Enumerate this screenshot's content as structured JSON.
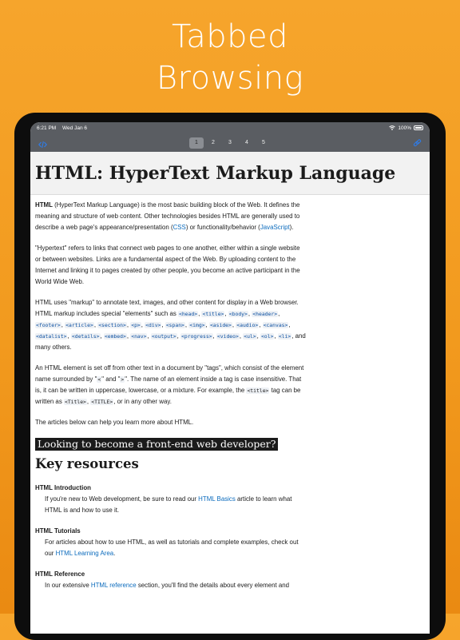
{
  "promo": {
    "line1": "Tabbed",
    "line2": "Browsing"
  },
  "status": {
    "time": "6:21 PM",
    "date": "Wed Jan 6",
    "battery": "100%"
  },
  "toolbar": {
    "tabs": [
      "1",
      "2",
      "3",
      "4",
      "5"
    ],
    "active_tab": "1",
    "left_icon": "code-icon",
    "right_icon": "link-icon",
    "accent": "#2f7be5"
  },
  "article": {
    "title": "HTML: HyperText Markup Language",
    "p1": {
      "term": "HTML",
      "text1": " (HyperText Markup Language) is the most basic building block of the Web. It defines the meaning and structure of web content. Other technologies besides HTML are generally used to describe a web page's appearance/presentation (",
      "link_css": "CSS",
      "text2": ") or functionality/behavior (",
      "link_js": "JavaScript",
      "text3": ")."
    },
    "p2": "\"Hypertext\" refers to links that connect web pages to one another, either within a single website or between websites. Links are a fundamental aspect of the Web. By uploading content to the Internet and linking it to pages created by other people, you become an active participant in the World Wide Web.",
    "p3": {
      "text1": "HTML uses \"markup\" to annotate text, images, and other content for display in a Web browser. HTML markup includes special \"elements\" such as ",
      "elements": [
        "<head>",
        "<title>",
        "<body>",
        "<header>",
        "<footer>",
        "<article>",
        "<section>",
        "<p>",
        "<div>",
        "<span>",
        "<img>",
        "<aside>",
        "<audio>",
        "<canvas>",
        "<datalist>",
        "<details>",
        "<embed>",
        "<nav>",
        "<output>",
        "<progress>",
        "<video>",
        "<ul>",
        "<ol>",
        "<li>"
      ],
      "text2": " and many others."
    },
    "p4": {
      "text1": "An HTML element is set off from other text in a document by \"tags\", which consist of the element name surrounded by \"",
      "lt": "<",
      "text2": "\" and \"",
      "gt": ">",
      "text3": "\".  The name of an element inside a tag is case insensitive. That is, it can be written in uppercase, lowercase, or a mixture. For example, the ",
      "code1": "<title>",
      "text4": " tag can be written as ",
      "code2": "<Title>",
      "text5": ", ",
      "code3": "<TITLE>",
      "text6": ", or in any other way."
    },
    "p5": "The articles below can help you learn more about HTML.",
    "cta": "Looking to become a front-end web developer?",
    "key_heading": "Key resources",
    "resources": [
      {
        "term": "HTML Introduction",
        "pre": "If you're new to Web development, be sure to read our ",
        "link": "HTML Basics",
        "post": " article to learn what HTML is and how to use it."
      },
      {
        "term": "HTML Tutorials",
        "pre": "For articles about how to use HTML, as well as tutorials and complete examples, check out our ",
        "link": "HTML Learning Area",
        "post": "."
      },
      {
        "term": "HTML Reference",
        "pre": "In our extensive ",
        "link": "HTML reference",
        "post": " section, you'll find the details about every element and"
      }
    ]
  }
}
